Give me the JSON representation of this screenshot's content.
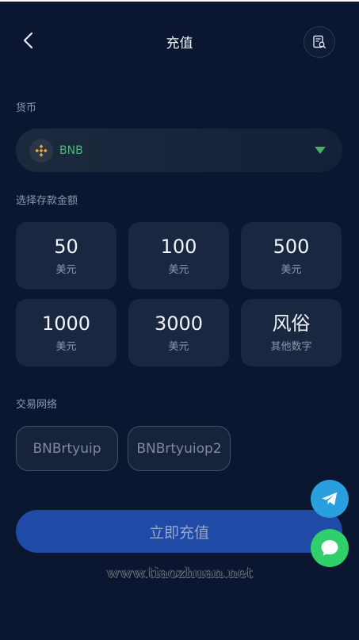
{
  "header": {
    "title": "充值",
    "back_icon": "chevron-left-icon",
    "record_icon": "record-search-icon"
  },
  "currency": {
    "label": "货币",
    "selected": "BNB",
    "icon": "bnb-coin-icon",
    "accent_color": "#4fb87a"
  },
  "amount": {
    "label": "选择存款金额",
    "options": [
      {
        "value": "50",
        "unit": "美元"
      },
      {
        "value": "100",
        "unit": "美元"
      },
      {
        "value": "500",
        "unit": "美元"
      },
      {
        "value": "1000",
        "unit": "美元"
      },
      {
        "value": "3000",
        "unit": "美元"
      },
      {
        "value": "风俗",
        "unit": "其他数字"
      }
    ]
  },
  "network": {
    "label": "交易网络",
    "options": [
      "BNBrtyuip",
      "BNBrtyuiop2"
    ]
  },
  "submit": {
    "label": "立即充值",
    "color": "#1f4aa6"
  },
  "watermark": "www.tiaozhuan.net",
  "floating": {
    "telegram_icon": "telegram-icon",
    "chat_icon": "chat-bubble-icon"
  }
}
